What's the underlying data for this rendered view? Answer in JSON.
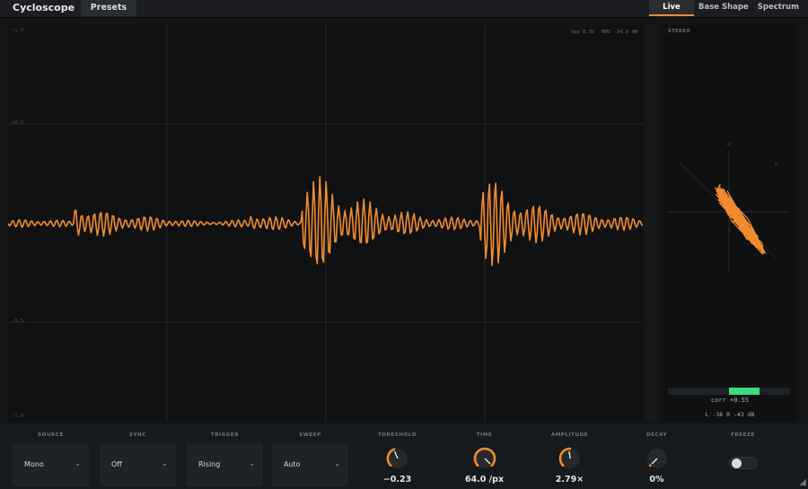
{
  "app": {
    "title": "Cycloscope",
    "presets_label": "Presets"
  },
  "tabs": [
    {
      "label": "Live",
      "active": true
    },
    {
      "label": "Base Shape",
      "active": false
    },
    {
      "label": "Spectrum",
      "active": false
    }
  ],
  "scope": {
    "ylabels": [
      "+1.0",
      "+0.5",
      "-0.5",
      "-1.0"
    ],
    "stats": {
      "vpp": "Vpp 0.35",
      "rms": "RMS -34.0 dB"
    },
    "waveform_color": "#f28b2e"
  },
  "stereo": {
    "label": "STEREO",
    "axis": {
      "m": "M",
      "l": "L",
      "r": "R"
    },
    "corr_text": "corr +0.55",
    "correlation": 0.55,
    "levels_text": "L  -38   R -43 dB"
  },
  "controls": {
    "source": {
      "label": "SOURCE",
      "value": "Mono"
    },
    "sync": {
      "label": "SYNC",
      "value": "Off"
    },
    "trigger": {
      "label": "TRIGGER",
      "value": "Rising"
    },
    "sweep": {
      "label": "SWEEP",
      "value": "Auto"
    },
    "threshold": {
      "label": "THRESHOLD",
      "value": "−0.23"
    },
    "time": {
      "label": "TIME",
      "value": "64.0 /px"
    },
    "amplitude": {
      "label": "AMPLITUDE",
      "value": "2.79×"
    },
    "decay": {
      "label": "DECAY",
      "value": "0%"
    },
    "freeze": {
      "label": "FREEZE",
      "on": false
    }
  },
  "colors": {
    "accent": "#f28b2e",
    "correlation": "#3ddc7e",
    "background": "#121416"
  }
}
